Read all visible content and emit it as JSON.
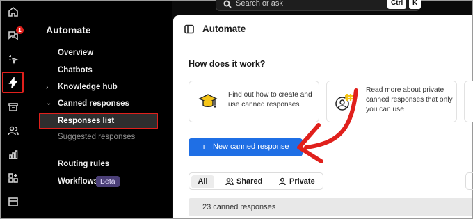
{
  "search": {
    "placeholder": "Search or ask",
    "kbd1": "Ctrl",
    "kbd2": "K"
  },
  "rail": {
    "notification_count": "1"
  },
  "sidebar": {
    "title": "Automate",
    "items": [
      {
        "label": "Overview"
      },
      {
        "label": "Chatbots"
      },
      {
        "label": "Knowledge hub"
      },
      {
        "label": "Canned responses"
      },
      {
        "label": "Responses list"
      },
      {
        "label": "Suggested responses"
      },
      {
        "label": "Routing rules"
      },
      {
        "label": "Workflows",
        "badge": "Beta"
      }
    ]
  },
  "main": {
    "title": "Automate",
    "how_heading": "How does it work?",
    "cards": [
      {
        "text": "Find out how to create and use canned responses",
        "icon": "graduation-cap-icon"
      },
      {
        "text": "Read more about private canned responses that only you can use",
        "icon": "user-hash-icon"
      }
    ],
    "new_button": "New canned response",
    "tabs": [
      {
        "label": "All"
      },
      {
        "label": "Shared"
      },
      {
        "label": "Private"
      }
    ],
    "count_text": "23 canned responses"
  },
  "colors": {
    "accent": "#1f6fe5",
    "highlight": "#e0201c",
    "beta_bg": "#4b3f77"
  }
}
